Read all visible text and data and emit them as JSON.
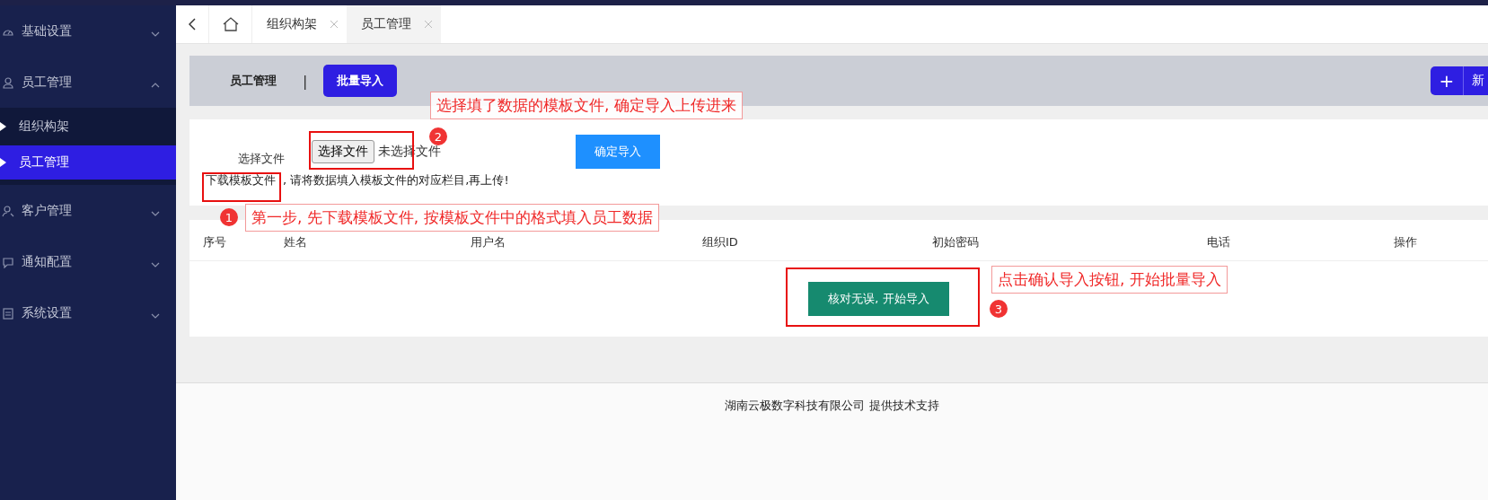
{
  "sidebar": {
    "items": [
      {
        "label": "基础设置",
        "expanded": false
      },
      {
        "label": "员工管理",
        "expanded": true,
        "children": [
          {
            "label": "组织构架",
            "selected": false
          },
          {
            "label": "员工管理",
            "selected": true
          }
        ]
      },
      {
        "label": "客户管理",
        "expanded": false
      },
      {
        "label": "通知配置",
        "expanded": false
      },
      {
        "label": "系统设置",
        "expanded": false
      }
    ]
  },
  "tabs": [
    {
      "label": "组织构架",
      "selected": false
    },
    {
      "label": "员工管理",
      "selected": true
    }
  ],
  "page_header": {
    "tabs": [
      {
        "label": "员工管理",
        "selected": false
      },
      {
        "label": "批量导入",
        "selected": true
      }
    ],
    "separator": "|",
    "add_button": {
      "icon": "+",
      "label": "新"
    }
  },
  "upload": {
    "label": "选择文件",
    "file_button": "选择文件",
    "file_status": "未选择文件",
    "submit": "确定导入",
    "download_link": "下载模板文件",
    "hint": ", 请将数据填入模板文件的对应栏目,再上传!"
  },
  "table": {
    "columns": [
      "序号",
      "姓名",
      "用户名",
      "组织ID",
      "初始密码",
      "电话",
      "操作"
    ],
    "action": "核对无误, 开始导入"
  },
  "footer": "湖南云极数字科技有限公司 提供技术支持",
  "annotations": [
    {
      "number": "1",
      "text": "第一步, 先下载模板文件, 按模板文件中的格式填入员工数据"
    },
    {
      "number": "2",
      "text": "选择填了数据的模板文件, 确定导入上传进来"
    },
    {
      "number": "3",
      "text": "点击确认导入按钮, 开始批量导入"
    }
  ]
}
